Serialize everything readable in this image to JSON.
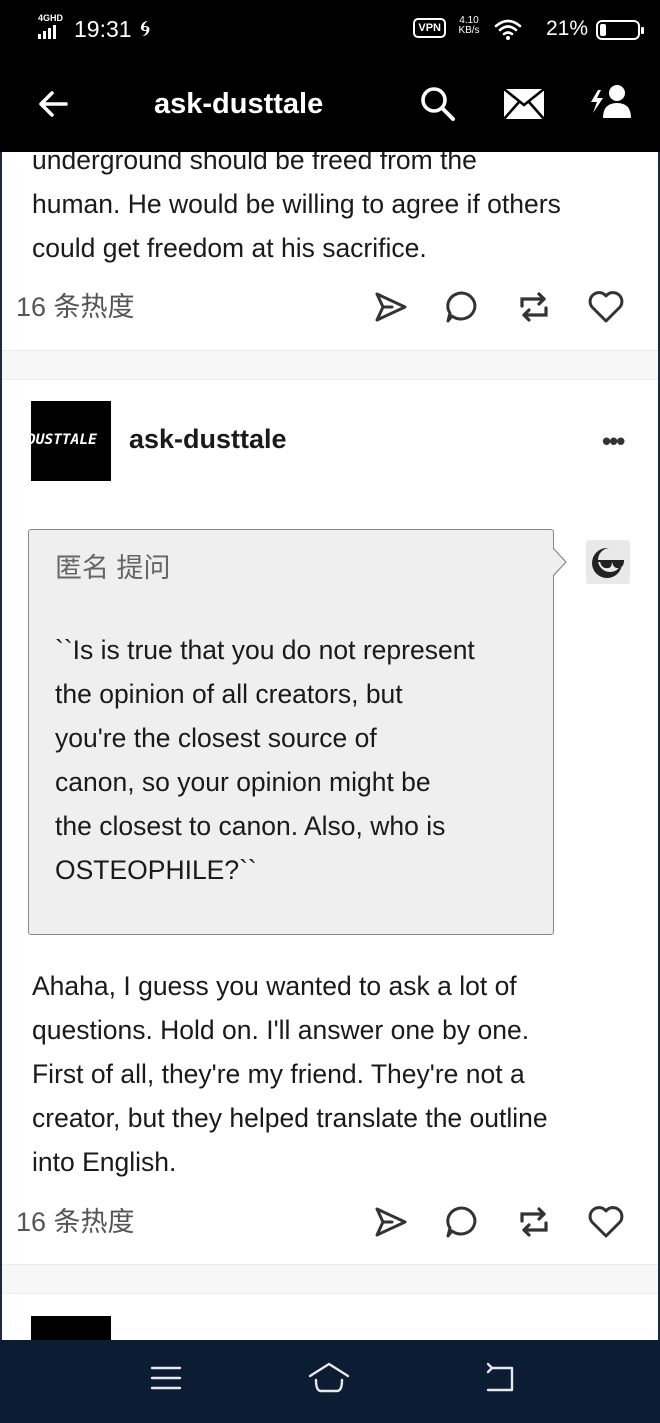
{
  "status_bar": {
    "network": "4GHD",
    "time": "19:31",
    "vpn": "VPN",
    "speed_value": "4.10",
    "speed_unit": "KB/s",
    "battery": "21%"
  },
  "header": {
    "title": "ask-dusttale"
  },
  "previous_post": {
    "text_clipped": "underground should be freed from the",
    "text_lines": [
      "human. He would be willing to agree if others",
      "could get freedom at his sacrifice."
    ],
    "notes": "16 条热度"
  },
  "post": {
    "blog_name": "ask-dusttale",
    "avatar_text": "DUSTTALE",
    "more": "•••",
    "ask_label": "匿名 提问",
    "question_lines": [
      "``Is is true that you do not represent",
      "the opinion of all creators, but",
      "you're the closest source of",
      "canon, so your opinion might be",
      "the closest to canon. Also, who is",
      "OSTEOPHILE?``"
    ],
    "answer_lines": [
      "Ahaha, I guess you wanted to ask a lot of",
      "questions. Hold on. I'll answer one by one.",
      "First of all, they're my friend. They're not a",
      "creator, but they helped translate the outline",
      "into English."
    ],
    "notes": "16 条热度"
  },
  "icons": {
    "share": "send-icon",
    "reply": "comment-icon",
    "reblog": "reblog-icon",
    "like": "heart-icon"
  }
}
